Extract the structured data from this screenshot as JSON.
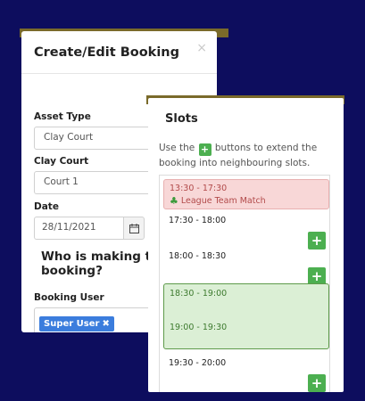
{
  "booking": {
    "title": "Create/Edit Booking",
    "close": "×",
    "asset_type": {
      "label": "Asset Type",
      "value": "Clay Court"
    },
    "clay_court": {
      "label": "Clay Court",
      "value": "Court 1"
    },
    "date": {
      "label": "Date",
      "value": "28/11/2021"
    },
    "who_heading": "Who is making the booking?",
    "booking_user": {
      "label": "Booking User",
      "tag": "Super User",
      "tag_remove": "✖"
    }
  },
  "slots": {
    "title": "Slots",
    "desc_before": "Use the",
    "desc_plus": "+",
    "desc_after": "buttons to extend the booking into neighbouring slots.",
    "booked": {
      "time": "13:30 - 17:30",
      "name": "League Team Match",
      "icon": "club-icon"
    },
    "items": [
      {
        "time": "17:30 - 18:00",
        "add": "+"
      },
      {
        "time": "18:00 - 18:30",
        "add": "+"
      },
      {
        "time": "19:30 - 20:00",
        "add": "+"
      }
    ],
    "selected": [
      "18:30 - 19:00",
      "19:00 - 19:30"
    ]
  }
}
